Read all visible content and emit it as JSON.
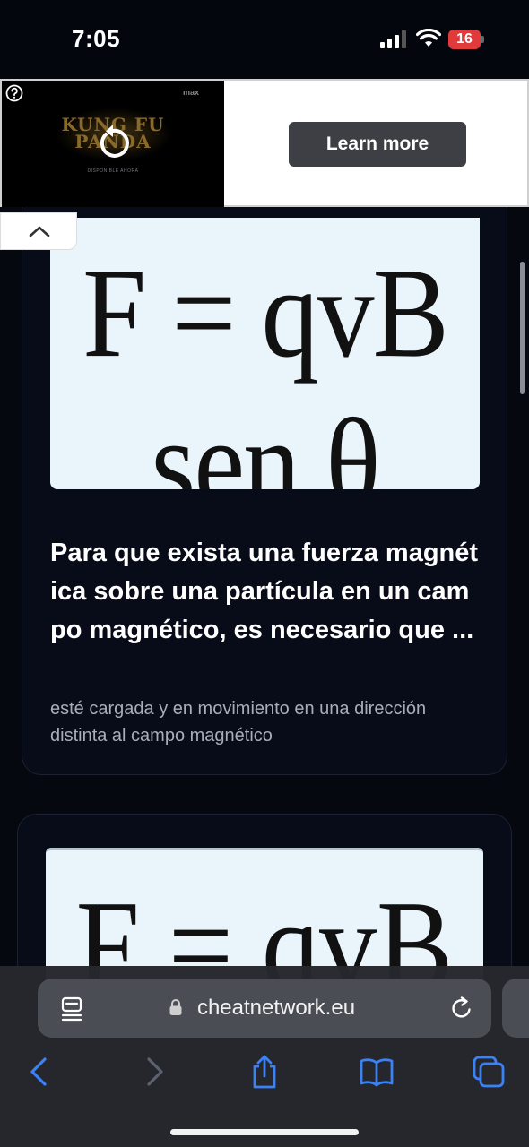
{
  "status_bar": {
    "time": "7:05",
    "battery_level": "16",
    "battery_color": "#e03a3a"
  },
  "ad": {
    "video_title_line1": "KUNG FU",
    "video_title_line2": "PANDA",
    "video_subtitle": "DISPONIBLE AHORA",
    "brand": "max",
    "cta_label": "Learn more",
    "icons": [
      "help-icon",
      "replay-icon",
      "chevron-up-icon"
    ]
  },
  "cards": [
    {
      "formula": "F = qvB sen θ",
      "question": "Para que exista una fuerza magnética sobre una partícula en un campo magnético, es necesario que ...",
      "answer": "esté cargada y en movimiento en una dirección distinta al campo magnético"
    },
    {
      "formula": "F = qvB sen θ"
    }
  ],
  "browser": {
    "url": "cheatnetwork.eu",
    "icons": [
      "reader-icon",
      "lock-icon",
      "reload-icon",
      "back-icon",
      "forward-icon",
      "share-icon",
      "bookmarks-icon",
      "tabs-icon"
    ],
    "accent_color": "#3b82f6"
  }
}
